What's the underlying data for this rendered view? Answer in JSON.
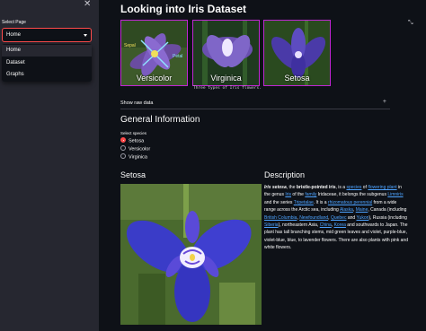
{
  "sidebar": {
    "label": "Select Page",
    "selected": "Home",
    "options": [
      "Home",
      "Dataset",
      "Graphs"
    ]
  },
  "main": {
    "title": "Looking into Iris Dataset",
    "thumbs": [
      {
        "caption": "Versicolor",
        "sepal_label": "Sepal",
        "petal_label": "Petal"
      },
      {
        "caption": "Virginica"
      },
      {
        "caption": "Setosa"
      }
    ],
    "image_caption": "Three types of Iris flowers.",
    "raw_data_label": "Show raw data",
    "general_info": "General Information",
    "radio_label": "Select species",
    "species": [
      "Setosa",
      "Versicolor",
      "Virginica"
    ],
    "selected_species": "Setosa",
    "species_heading": "Setosa",
    "description_heading": "Description",
    "description_parts": {
      "p1_i": "Iris setosa",
      "p1_a": ", the ",
      "p1_b": "bristle-pointed iris",
      "p1_c": ", is a ",
      "link_species": "species",
      "p1_d": " of ",
      "link_flowering": "flowering plant",
      "p1_e": " in the genus ",
      "link_iris": "Iris",
      "p1_f": " of the ",
      "link_family": "family",
      "p1_g": " Iridaceae, it belongs the subgenus ",
      "link_limniris": "Limniris",
      "p1_h": " and the series ",
      "link_tripetalae": "Tripetalae",
      "p1_j": ". It is a ",
      "link_rhizomatous": "rhizomatous perennial",
      "p1_k": " from a wide range across the Arctic sea, including ",
      "link_alaska": "Alaska",
      "sep1": ", ",
      "link_maine": "Maine",
      "p1_l": ", Canada (including ",
      "link_bc": "British Columbia",
      "sep2": ", ",
      "link_nf": "Newfoundland",
      "sep3": ", ",
      "link_quebec": "Quebec",
      "p1_m": " and ",
      "link_yukon": "Yukon",
      "p1_n": "), Russia (including ",
      "link_siberia": "Siberia",
      "p1_o": "), northeastern Asia, ",
      "link_china": "China",
      "sep4": ", ",
      "link_korea": "Korea",
      "p1_p": " and southwards to Japan. The plant has tall branching stems, mid green leaves and violet, purple-blue, violet-blue, blue, to lavender flowers. There are also plants with pink and white flowers."
    }
  },
  "colors": {
    "accent": "#ff4b4b",
    "thumb_border": "#c026d3",
    "link": "#4da3ff"
  },
  "icons": {
    "close": "close-icon",
    "expand": "fullscreen-icon",
    "collapse_plus": "plus-icon"
  }
}
